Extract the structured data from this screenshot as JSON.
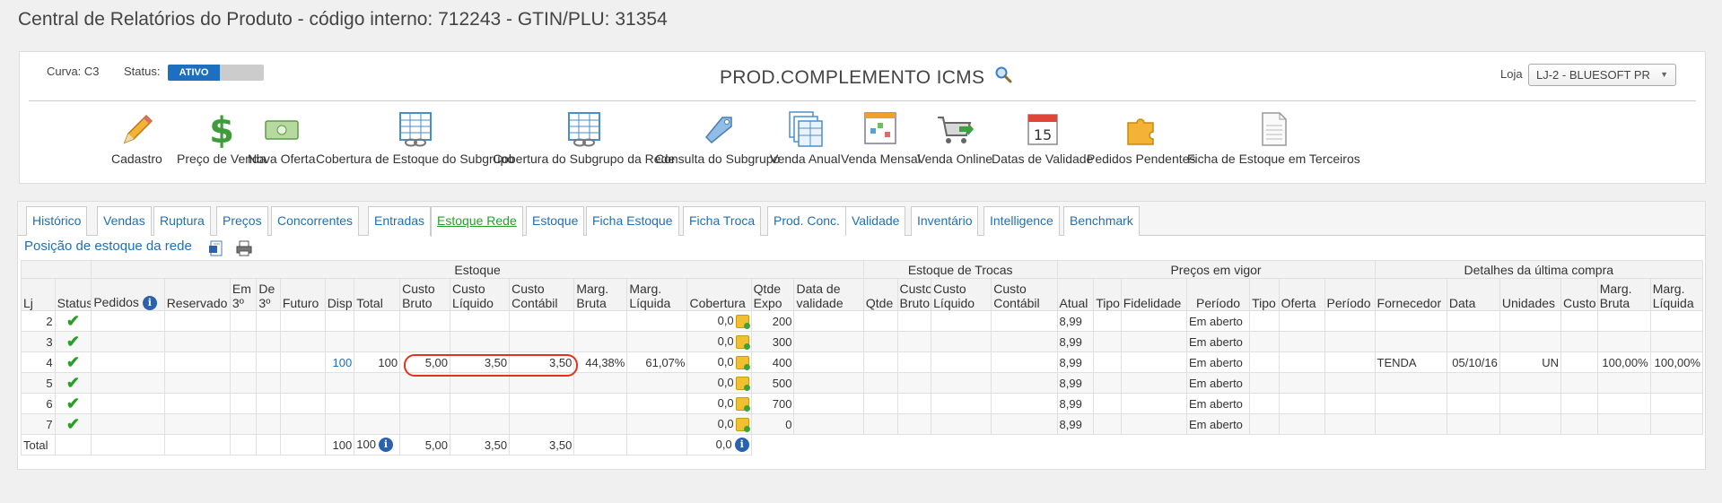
{
  "page": {
    "title": "Central de Relatórios do Produto - código interno: 712243 - GTIN/PLU: 31354"
  },
  "header": {
    "curva": "Curva: C3",
    "status_label": "Status:",
    "status_value": "ATIVO",
    "product_name": "PROD.COMPLEMENTO ICMS",
    "loja_label": "Loja",
    "loja_value": "LJ-2 - BLUESOFT PR"
  },
  "toolbar": [
    {
      "label": "Cadastro",
      "icon": "pencil-icon"
    },
    {
      "label": "Preço de Venda",
      "icon": "dollar-icon"
    },
    {
      "label": "Nova Oferta",
      "icon": "banknote-icon"
    },
    {
      "label": "Cobertura de Estoque do Subgrupo",
      "icon": "spreadsheet-chain-icon"
    },
    {
      "label": "Cobertura do Subgrupo da Rede",
      "icon": "spreadsheet-chain-icon"
    },
    {
      "label": "Consulta do Subgrupo",
      "icon": "tag-icon"
    },
    {
      "label": "Venda Anual",
      "icon": "stacked-sheets-icon"
    },
    {
      "label": "Venda Mensal",
      "icon": "chart-sheet-icon"
    },
    {
      "label": "Venda Online",
      "icon": "cart-icon"
    },
    {
      "label": "Datas de Validade",
      "icon": "calendar-icon",
      "calendar_day": "15"
    },
    {
      "label": "Pedidos Pendentes",
      "icon": "puzzle-icon"
    },
    {
      "label": "Ficha de Estoque em Terceiros",
      "icon": "document-icon"
    }
  ],
  "tabs": [
    "Histórico",
    "Vendas",
    "Ruptura",
    "Preços",
    "Concorrentes",
    "Entradas",
    "Estoque Rede",
    "Estoque",
    "Ficha Estoque",
    "Ficha Troca",
    "Prod. Conc.",
    "Validade",
    "Inventário",
    "Intelligence",
    "Benchmark"
  ],
  "active_tab": "Estoque Rede",
  "section": {
    "title": "Posição de estoque da rede"
  },
  "table": {
    "groups": {
      "estoque": "Estoque",
      "trocas": "Estoque de Trocas",
      "precos": "Preços em vigor",
      "compra": "Detalhes da última compra"
    },
    "columns": [
      "Lj",
      "Status",
      "Pedidos",
      "Reservado",
      "Em 3º",
      "De 3º",
      "Futuro",
      "Disp",
      "Total",
      "Custo Bruto",
      "Custo Líquido",
      "Custo Contábil",
      "Marg. Bruta",
      "Marg. Líquida",
      "Cobertura",
      "Qtde Expo",
      "Data de validade",
      "Qtde",
      "Custo Bruto",
      "Custo Líquido",
      "Custo Contábil",
      "Atual",
      "Tipo",
      "Fidelidade",
      "Período",
      "Tipo",
      "Oferta",
      "Período",
      "Fornecedor",
      "Data",
      "Unidades",
      "Custo",
      "Marg. Bruta",
      "Marg. Líquida"
    ],
    "rows": [
      {
        "lj": "2",
        "disp": "",
        "total": "",
        "cb": "",
        "cl": "",
        "cc": "",
        "mb": "",
        "ml": "",
        "cob": "0,0",
        "expo": "200",
        "atual": "8,99",
        "periodo": "Em aberto",
        "forn": "",
        "data": "",
        "un": "",
        "cmb": "",
        "cml": ""
      },
      {
        "lj": "3",
        "disp": "",
        "total": "",
        "cb": "",
        "cl": "",
        "cc": "",
        "mb": "",
        "ml": "",
        "cob": "0,0",
        "expo": "300",
        "atual": "8,99",
        "periodo": "Em aberto",
        "forn": "",
        "data": "",
        "un": "",
        "cmb": "",
        "cml": ""
      },
      {
        "lj": "4",
        "disp": "100",
        "total": "100",
        "cb": "5,00",
        "cl": "3,50",
        "cc": "3,50",
        "mb": "44,38%",
        "ml": "61,07%",
        "cob": "0,0",
        "expo": "400",
        "atual": "8,99",
        "periodo": "Em aberto",
        "forn": "TENDA",
        "data": "05/10/16",
        "un": "UN",
        "cmb": "100,00%",
        "cml": "100,00%"
      },
      {
        "lj": "5",
        "disp": "",
        "total": "",
        "cb": "",
        "cl": "",
        "cc": "",
        "mb": "",
        "ml": "",
        "cob": "0,0",
        "expo": "500",
        "atual": "8,99",
        "periodo": "Em aberto",
        "forn": "",
        "data": "",
        "un": "",
        "cmb": "",
        "cml": ""
      },
      {
        "lj": "6",
        "disp": "",
        "total": "",
        "cb": "",
        "cl": "",
        "cc": "",
        "mb": "",
        "ml": "",
        "cob": "0,0",
        "expo": "700",
        "atual": "8,99",
        "periodo": "Em aberto",
        "forn": "",
        "data": "",
        "un": "",
        "cmb": "",
        "cml": ""
      },
      {
        "lj": "7",
        "disp": "",
        "total": "",
        "cb": "",
        "cl": "",
        "cc": "",
        "mb": "",
        "ml": "",
        "cob": "0,0",
        "expo": "0",
        "atual": "8,99",
        "periodo": "Em aberto",
        "forn": "",
        "data": "",
        "un": "",
        "cmb": "",
        "cml": ""
      }
    ],
    "totals": {
      "label": "Total",
      "disp": "100",
      "total": "100",
      "cb": "5,00",
      "cl": "3,50",
      "cc": "3,50",
      "cob": "0,0"
    }
  },
  "colors": {
    "accent": "#1f6fb5",
    "active_tab": "#2a9d2a",
    "status_on": "#1e6fc0",
    "highlight": "#e0331c"
  }
}
